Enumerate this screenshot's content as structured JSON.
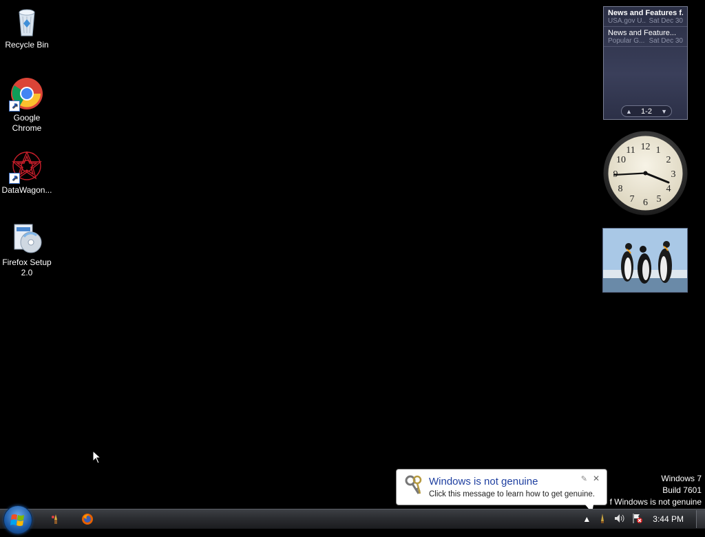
{
  "desktop": {
    "icons": [
      {
        "label": "Recycle Bin",
        "icon": "recycle-bin-icon"
      },
      {
        "label": "Google Chrome",
        "icon": "chrome-icon"
      },
      {
        "label": "DataWagon...",
        "icon": "datawagon-icon"
      },
      {
        "label": "Firefox Setup 2.0",
        "icon": "installer-icon"
      }
    ]
  },
  "gadgets": {
    "feed": {
      "items": [
        {
          "title": "News and Features f...",
          "source": "USA.gov U...",
          "date": "Sat Dec 30"
        },
        {
          "title": "News and Feature...",
          "source": "Popular G...",
          "date": "Sat Dec 30"
        }
      ],
      "page_indicator": "1-2"
    },
    "clock": {
      "time": "3:44"
    },
    "slideshow": {
      "image": "penguins"
    }
  },
  "watermark": {
    "line1": "Windows 7",
    "line2": "Build 7601",
    "line3": "f Windows is not genuine"
  },
  "balloon": {
    "title": "Windows is not genuine",
    "message": "Click this message to learn how to get genuine."
  },
  "taskbar": {
    "start": "start-orb",
    "quick_launch": [
      "paint-icon",
      "firefox-icon"
    ],
    "tray": {
      "time": "3:44 PM",
      "icons": [
        "show-hidden-icons-arrow",
        "genuine-warning-icon",
        "volume-icon",
        "action-center-flag-icon"
      ]
    }
  },
  "colors": {
    "desktop_bg": "#000000",
    "balloon_title": "#1e3fa0",
    "gadget_bg": "#2f3450"
  }
}
